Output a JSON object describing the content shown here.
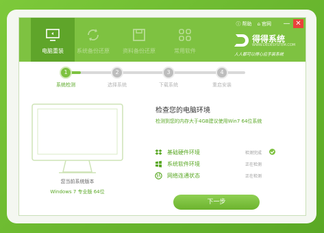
{
  "colors": {
    "brand_green": "#7ec241",
    "dark_green": "#5aa825",
    "close_red": "#e9433b"
  },
  "titlebar": {
    "nav": [
      {
        "label": "电脑重装",
        "icon": "monitor-icon"
      },
      {
        "label": "系统备份还原",
        "icon": "refresh-icon"
      },
      {
        "label": "资料备份还原",
        "icon": "save-icon"
      },
      {
        "label": "常用软件",
        "icon": "apps-icon"
      }
    ],
    "help": "帮助",
    "website": "官网",
    "min": "—",
    "close": "✕",
    "logo_text": "得得系统",
    "logo_sub": "WWW.DEDESYSTEM.COM",
    "logo_tag": "人人都可以得心应手装系统"
  },
  "steps": [
    {
      "num": "1",
      "label": "系统检测"
    },
    {
      "num": "2",
      "label": "选择系统"
    },
    {
      "num": "3",
      "label": "下载系统"
    },
    {
      "num": "4",
      "label": "重启安装"
    }
  ],
  "system": {
    "current_label": "您当前系统版本",
    "version": "Windows 7 专业版 64位"
  },
  "check": {
    "title": "检查您的电脑环境",
    "desc": "检测到您的内存大于4GB建议使用Win7 64位系统",
    "items": [
      {
        "name": "基础硬件环境",
        "status": "检测完成",
        "icon": "dropbox-icon"
      },
      {
        "name": "系统软件环境",
        "status": "正在检测",
        "icon": "windows-icon"
      },
      {
        "name": "网络连通状态",
        "status": "正在检测",
        "icon": "globe-icon"
      }
    ]
  },
  "next_button": "下一步"
}
